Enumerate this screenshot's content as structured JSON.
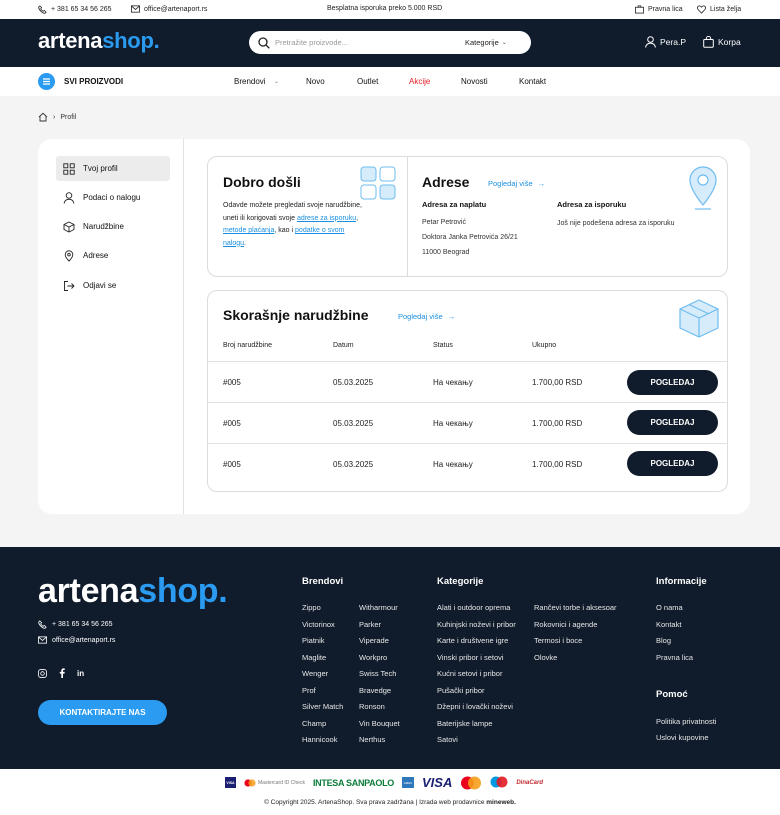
{
  "topbar": {
    "phone": "+ 381 65 34 56 265",
    "email": "office@artenaport.rs",
    "shipping": "Besplatna isporuka preko 5.000 RSD",
    "legal": "Pravna lica",
    "wishlist": "Lista želja"
  },
  "header": {
    "logo_part1": "artena",
    "logo_part2": "shop.",
    "search_placeholder": "Pretražite proizvode...",
    "category_label": "Kategorije",
    "user_label": "Pera.P",
    "cart_label": "Korpa"
  },
  "nav": {
    "all_products": "SVI PROIZVODI",
    "items": [
      "Brendovi",
      "Novo",
      "Outlet",
      "Akcije",
      "Novosti",
      "Kontakt"
    ],
    "highlight_color": "#e31b23"
  },
  "breadcrumb": {
    "current": "Profil"
  },
  "sidebar": {
    "items": [
      {
        "label": "Tvoj profil",
        "icon": "grid-icon"
      },
      {
        "label": "Podaci o nalogu",
        "icon": "user-icon"
      },
      {
        "label": "Narudžbine",
        "icon": "box-icon"
      },
      {
        "label": "Adrese",
        "icon": "location-icon"
      },
      {
        "label": "Odjavi se",
        "icon": "logout-icon"
      }
    ]
  },
  "welcome": {
    "title": "Dobro došli",
    "text1": "Odavde možete pregledati svoje narudžbine, uneti ili korigovati svoje",
    "link1": "adrese za isporuku",
    "sep1": ",",
    "link2": "metode plaćanja",
    "text2": ",",
    "text3": "kao i",
    "link3": "podatke o svom nalogu",
    "text4": "."
  },
  "addresses": {
    "title": "Adrese",
    "view_more": "Pogledaj više",
    "billing_title": "Adresa za naplatu",
    "billing_name": "Petar Petrović",
    "billing_street": "Doktora Janka Petrovića 26/21",
    "billing_city": "11000 Beograd",
    "shipping_title": "Adresa za isporuku",
    "shipping_text": "Još nije podešena adresa za isporuku"
  },
  "orders": {
    "title": "Skorašnje narudžbine",
    "view_more": "Pogledaj više",
    "headers": [
      "Broj narudžbine",
      "Datum",
      "Status",
      "Ukupno"
    ],
    "rows": [
      {
        "number": "#005",
        "date": "05.03.2025",
        "status": "На чекању",
        "total": "1.700,00 RSD",
        "action": "POGLEDAJ"
      },
      {
        "number": "#005",
        "date": "05.03.2025",
        "status": "На чекању",
        "total": "1.700,00 RSD",
        "action": "POGLEDAJ"
      },
      {
        "number": "#005",
        "date": "05.03.2025",
        "status": "На чекању",
        "total": "1.700,00 RSD",
        "action": "POGLEDAJ"
      }
    ]
  },
  "footer": {
    "logo_part1": "artena",
    "logo_part2": "shop.",
    "phone": "+ 381 65 34 56 265",
    "email": "office@artenaport.rs",
    "contact_button": "KONTAKTIRAJTE NAS",
    "brands_title": "Brendovi",
    "brands_col1": [
      "Zippo",
      "Victorinox",
      "Piatnik",
      "Maglite",
      "Wenger",
      "Prof",
      "Silver Match",
      "Champ",
      "Hannicook"
    ],
    "brands_col2": [
      "Witharmour",
      "Parker",
      "Viperade",
      "Workpro",
      "Swiss Tech",
      "Bravedge",
      "Ronson",
      "Vin Bouquet",
      "Nerthus"
    ],
    "categories_title": "Kategorije",
    "categories_col1": [
      "Alati i outdoor oprema",
      "Kuhinjski noževi i pribor",
      "Karte i društvene igre",
      "Vinski pribor i setovi",
      "Kućni setovi i pribor",
      "Pušački pribor",
      "Džepni i lovački noževi",
      "Baterijske lampe",
      "Satovi"
    ],
    "categories_col2": [
      "Rančevi torbe i aksesoar",
      "Rokovnici i agende",
      "Termosi i boce",
      "Olovke"
    ],
    "info_title": "Informacije",
    "info_items": [
      "O nama",
      "Kontakt",
      "Blog",
      "Pravna lica"
    ],
    "help_title": "Pomoć",
    "help_items": [
      "Politika privatnosti",
      "Uslovi kupovine"
    ]
  },
  "payments": {
    "items": [
      "Visa",
      "Mastercard ID Check",
      "INTESA SANPAOLO",
      "American Express",
      "VISA",
      "Mastercard",
      "Maestro",
      "DinaCard"
    ]
  },
  "copyright": {
    "text": "© Copyright 2025. ArtenaShop. Sva prava zadržana | Izrada web prodavnice",
    "brand": "mineweb."
  },
  "colors": {
    "brand": "#2a9bf0",
    "dark": "#101b2b",
    "accent_red": "#e31b23"
  }
}
